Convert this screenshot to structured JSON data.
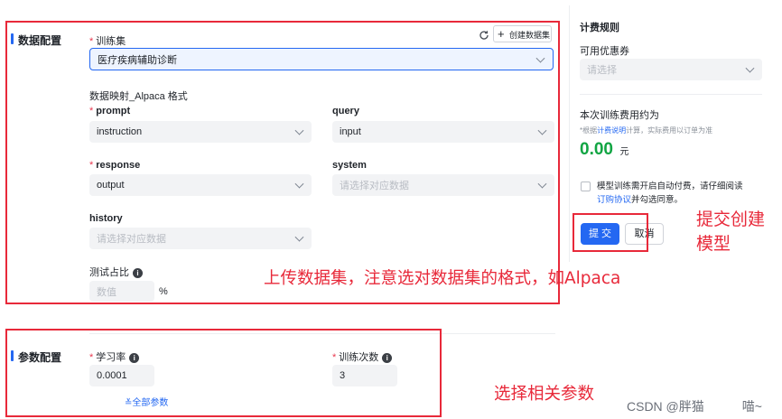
{
  "data_section": {
    "title": "数据配置",
    "training_set": {
      "label": "训练集",
      "value": "医疗疾病辅助诊断",
      "create_label": "创建数据集"
    },
    "mapping_title": "数据映射_Alpaca 格式",
    "prompt": {
      "label": "prompt",
      "value": "instruction"
    },
    "query": {
      "label": "query",
      "value": "input"
    },
    "response": {
      "label": "response",
      "value": "output"
    },
    "system": {
      "label": "system",
      "placeholder": "请选择对应数据"
    },
    "history": {
      "label": "history",
      "placeholder": "请选择对应数据"
    },
    "test_ratio": {
      "label": "测试占比",
      "placeholder": "数值",
      "unit": "%"
    }
  },
  "param_section": {
    "title": "参数配置",
    "learning_rate": {
      "label": "学习率",
      "value": "0.0001"
    },
    "epochs": {
      "label": "训练次数",
      "value": "3"
    },
    "all_params_label": "全部参数"
  },
  "billing": {
    "title": "计费规则",
    "coupon_label": "可用优惠券",
    "coupon_placeholder": "请选择",
    "fee_title": "本次训练费用约为",
    "note_prefix": "*根据",
    "note_link": "计费说明",
    "note_suffix": "计算，实际费用以订单为准",
    "amount": "0.00",
    "currency": "元",
    "agree_text": "模型训练需开启自动付费，请仔细阅读",
    "agree_link": "订购协议",
    "agree_suffix": "并勾选同意。",
    "submit_label": "提 交",
    "cancel_label": "取消"
  },
  "annotations": {
    "upload_note": "上传数据集，注意选对数据集的格式，如Alpaca",
    "submit_note_line1": "提交创建",
    "submit_note_line2": "模型",
    "params_note": "选择相关参数"
  },
  "watermark": "CSDN @胖猫　　　喵~",
  "colors": {
    "primary": "#2468f2",
    "annotation": "#e8293a",
    "amount": "#11a543"
  }
}
